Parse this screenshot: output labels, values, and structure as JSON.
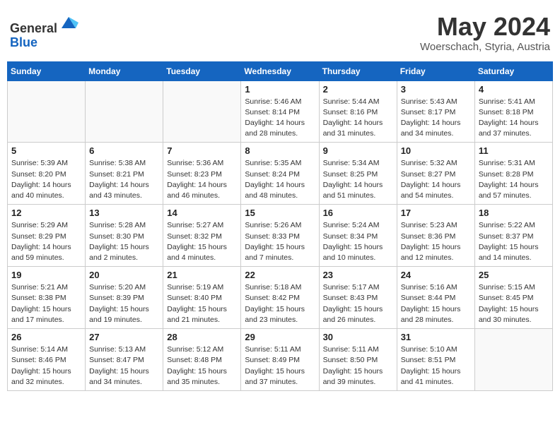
{
  "header": {
    "logo_line1": "General",
    "logo_line2": "Blue",
    "title": "May 2024",
    "subtitle": "Woerschach, Styria, Austria"
  },
  "calendar": {
    "days_of_week": [
      "Sunday",
      "Monday",
      "Tuesday",
      "Wednesday",
      "Thursday",
      "Friday",
      "Saturday"
    ],
    "weeks": [
      [
        {
          "day": "",
          "info": ""
        },
        {
          "day": "",
          "info": ""
        },
        {
          "day": "",
          "info": ""
        },
        {
          "day": "1",
          "info": "Sunrise: 5:46 AM\nSunset: 8:14 PM\nDaylight: 14 hours\nand 28 minutes."
        },
        {
          "day": "2",
          "info": "Sunrise: 5:44 AM\nSunset: 8:16 PM\nDaylight: 14 hours\nand 31 minutes."
        },
        {
          "day": "3",
          "info": "Sunrise: 5:43 AM\nSunset: 8:17 PM\nDaylight: 14 hours\nand 34 minutes."
        },
        {
          "day": "4",
          "info": "Sunrise: 5:41 AM\nSunset: 8:18 PM\nDaylight: 14 hours\nand 37 minutes."
        }
      ],
      [
        {
          "day": "5",
          "info": "Sunrise: 5:39 AM\nSunset: 8:20 PM\nDaylight: 14 hours\nand 40 minutes."
        },
        {
          "day": "6",
          "info": "Sunrise: 5:38 AM\nSunset: 8:21 PM\nDaylight: 14 hours\nand 43 minutes."
        },
        {
          "day": "7",
          "info": "Sunrise: 5:36 AM\nSunset: 8:23 PM\nDaylight: 14 hours\nand 46 minutes."
        },
        {
          "day": "8",
          "info": "Sunrise: 5:35 AM\nSunset: 8:24 PM\nDaylight: 14 hours\nand 48 minutes."
        },
        {
          "day": "9",
          "info": "Sunrise: 5:34 AM\nSunset: 8:25 PM\nDaylight: 14 hours\nand 51 minutes."
        },
        {
          "day": "10",
          "info": "Sunrise: 5:32 AM\nSunset: 8:27 PM\nDaylight: 14 hours\nand 54 minutes."
        },
        {
          "day": "11",
          "info": "Sunrise: 5:31 AM\nSunset: 8:28 PM\nDaylight: 14 hours\nand 57 minutes."
        }
      ],
      [
        {
          "day": "12",
          "info": "Sunrise: 5:29 AM\nSunset: 8:29 PM\nDaylight: 14 hours\nand 59 minutes."
        },
        {
          "day": "13",
          "info": "Sunrise: 5:28 AM\nSunset: 8:30 PM\nDaylight: 15 hours\nand 2 minutes."
        },
        {
          "day": "14",
          "info": "Sunrise: 5:27 AM\nSunset: 8:32 PM\nDaylight: 15 hours\nand 4 minutes."
        },
        {
          "day": "15",
          "info": "Sunrise: 5:26 AM\nSunset: 8:33 PM\nDaylight: 15 hours\nand 7 minutes."
        },
        {
          "day": "16",
          "info": "Sunrise: 5:24 AM\nSunset: 8:34 PM\nDaylight: 15 hours\nand 10 minutes."
        },
        {
          "day": "17",
          "info": "Sunrise: 5:23 AM\nSunset: 8:36 PM\nDaylight: 15 hours\nand 12 minutes."
        },
        {
          "day": "18",
          "info": "Sunrise: 5:22 AM\nSunset: 8:37 PM\nDaylight: 15 hours\nand 14 minutes."
        }
      ],
      [
        {
          "day": "19",
          "info": "Sunrise: 5:21 AM\nSunset: 8:38 PM\nDaylight: 15 hours\nand 17 minutes."
        },
        {
          "day": "20",
          "info": "Sunrise: 5:20 AM\nSunset: 8:39 PM\nDaylight: 15 hours\nand 19 minutes."
        },
        {
          "day": "21",
          "info": "Sunrise: 5:19 AM\nSunset: 8:40 PM\nDaylight: 15 hours\nand 21 minutes."
        },
        {
          "day": "22",
          "info": "Sunrise: 5:18 AM\nSunset: 8:42 PM\nDaylight: 15 hours\nand 23 minutes."
        },
        {
          "day": "23",
          "info": "Sunrise: 5:17 AM\nSunset: 8:43 PM\nDaylight: 15 hours\nand 26 minutes."
        },
        {
          "day": "24",
          "info": "Sunrise: 5:16 AM\nSunset: 8:44 PM\nDaylight: 15 hours\nand 28 minutes."
        },
        {
          "day": "25",
          "info": "Sunrise: 5:15 AM\nSunset: 8:45 PM\nDaylight: 15 hours\nand 30 minutes."
        }
      ],
      [
        {
          "day": "26",
          "info": "Sunrise: 5:14 AM\nSunset: 8:46 PM\nDaylight: 15 hours\nand 32 minutes."
        },
        {
          "day": "27",
          "info": "Sunrise: 5:13 AM\nSunset: 8:47 PM\nDaylight: 15 hours\nand 34 minutes."
        },
        {
          "day": "28",
          "info": "Sunrise: 5:12 AM\nSunset: 8:48 PM\nDaylight: 15 hours\nand 35 minutes."
        },
        {
          "day": "29",
          "info": "Sunrise: 5:11 AM\nSunset: 8:49 PM\nDaylight: 15 hours\nand 37 minutes."
        },
        {
          "day": "30",
          "info": "Sunrise: 5:11 AM\nSunset: 8:50 PM\nDaylight: 15 hours\nand 39 minutes."
        },
        {
          "day": "31",
          "info": "Sunrise: 5:10 AM\nSunset: 8:51 PM\nDaylight: 15 hours\nand 41 minutes."
        },
        {
          "day": "",
          "info": ""
        }
      ]
    ]
  }
}
